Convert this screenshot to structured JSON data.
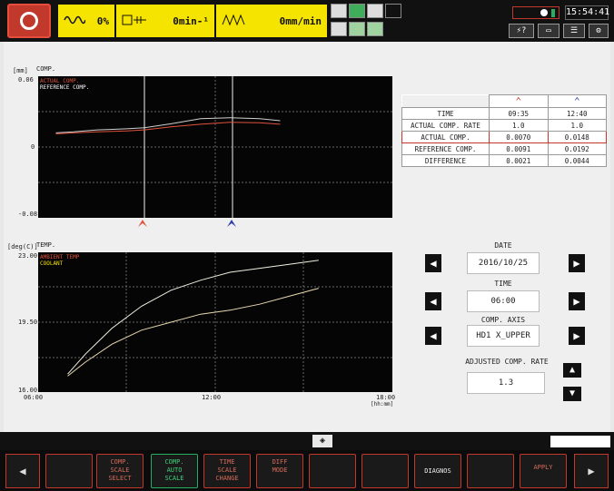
{
  "topbar": {
    "feed_override": "0%",
    "spindle": "0min-¹",
    "feed_rate": "0mm/min",
    "clock": "15:54:41"
  },
  "comp_chart": {
    "unit": "[mm]",
    "title": "COMP.",
    "ytop": "0.06",
    "ymid": "0",
    "ybottom": "-0.08",
    "legend": [
      {
        "label": "ACTUAL COMP.",
        "color": "#e0533d"
      },
      {
        "label": "REFERENCE COMP.",
        "color": "#ffffff"
      }
    ]
  },
  "temp_chart": {
    "unit": "[deg(C)]",
    "title": "TEMP.",
    "ytop": "23.00",
    "ymid": "19.50",
    "ybottom": "16.00",
    "xleft": "06:00",
    "xmid": "12:00",
    "xright": "18:00",
    "xunit": "[hh:mm]",
    "legend": [
      {
        "label": "AMBIENT TEMP",
        "color": "#e0533d"
      },
      {
        "label": "COOLANT",
        "color": "#f5e400"
      }
    ]
  },
  "table": {
    "rows": [
      {
        "label": "TIME",
        "a": "09:35",
        "b": "12:40"
      },
      {
        "label": "ACTUAL COMP. RATE",
        "a": "1.0",
        "b": "1.0"
      },
      {
        "label": "ACTUAL COMP.",
        "a": "0.0070",
        "b": "0.0148"
      },
      {
        "label": "REFERENCE COMP.",
        "a": "0.0091",
        "b": "0.0192"
      },
      {
        "label": "DIFFERENCE",
        "a": "0.0021",
        "b": "0.0044"
      }
    ]
  },
  "controls": {
    "date_label": "DATE",
    "date_value": "2016/10/25",
    "time_label": "TIME",
    "time_value": "06:00",
    "axis_label": "COMP. AXIS",
    "axis_value": "HD1 X_UPPER",
    "rate_label": "ADJUSTED COMP. RATE",
    "rate_value": "1.3"
  },
  "softkeys": {
    "k1": "COMP.\nSCALE\nSELECT",
    "k2": "COMP.\nAUTO\nSCALE",
    "k3": "TIME\nSCALE\nCHANGE",
    "k4": "DIFF\nMODE",
    "k5": "DIAGNOS",
    "k6": "APPLY"
  },
  "chart_data": [
    {
      "type": "line",
      "title": "COMP.",
      "ylabel": "[mm]",
      "ylim": [
        -0.08,
        0.06
      ],
      "x": [
        6.6,
        7.2,
        8.0,
        9.0,
        9.6,
        10.5,
        11.5,
        12.5,
        13.5,
        14.2
      ],
      "series": [
        {
          "name": "ACTUAL COMP.",
          "values": [
            0.003,
            0.004,
            0.005,
            0.006,
            0.007,
            0.01,
            0.0125,
            0.0145,
            0.014,
            0.0125
          ]
        },
        {
          "name": "REFERENCE COMP.",
          "values": [
            0.004,
            0.005,
            0.007,
            0.008,
            0.009,
            0.013,
            0.018,
            0.019,
            0.018,
            0.016
          ]
        }
      ]
    },
    {
      "type": "line",
      "title": "TEMP.",
      "ylabel": "[deg(C)]",
      "ylim": [
        16.0,
        23.0
      ],
      "xlim": [
        6,
        18
      ],
      "x": [
        7.0,
        7.6,
        8.5,
        9.5,
        10.5,
        11.5,
        12.5,
        13.5,
        14.5,
        15.5
      ],
      "series": [
        {
          "name": "AMBIENT TEMP",
          "values": [
            16.8,
            17.5,
            18.4,
            19.1,
            19.5,
            19.9,
            20.1,
            20.4,
            20.8,
            21.2
          ]
        },
        {
          "name": "COOLANT",
          "values": [
            16.9,
            17.9,
            19.2,
            20.3,
            21.1,
            21.6,
            22.0,
            22.2,
            22.4,
            22.6
          ]
        }
      ]
    }
  ]
}
